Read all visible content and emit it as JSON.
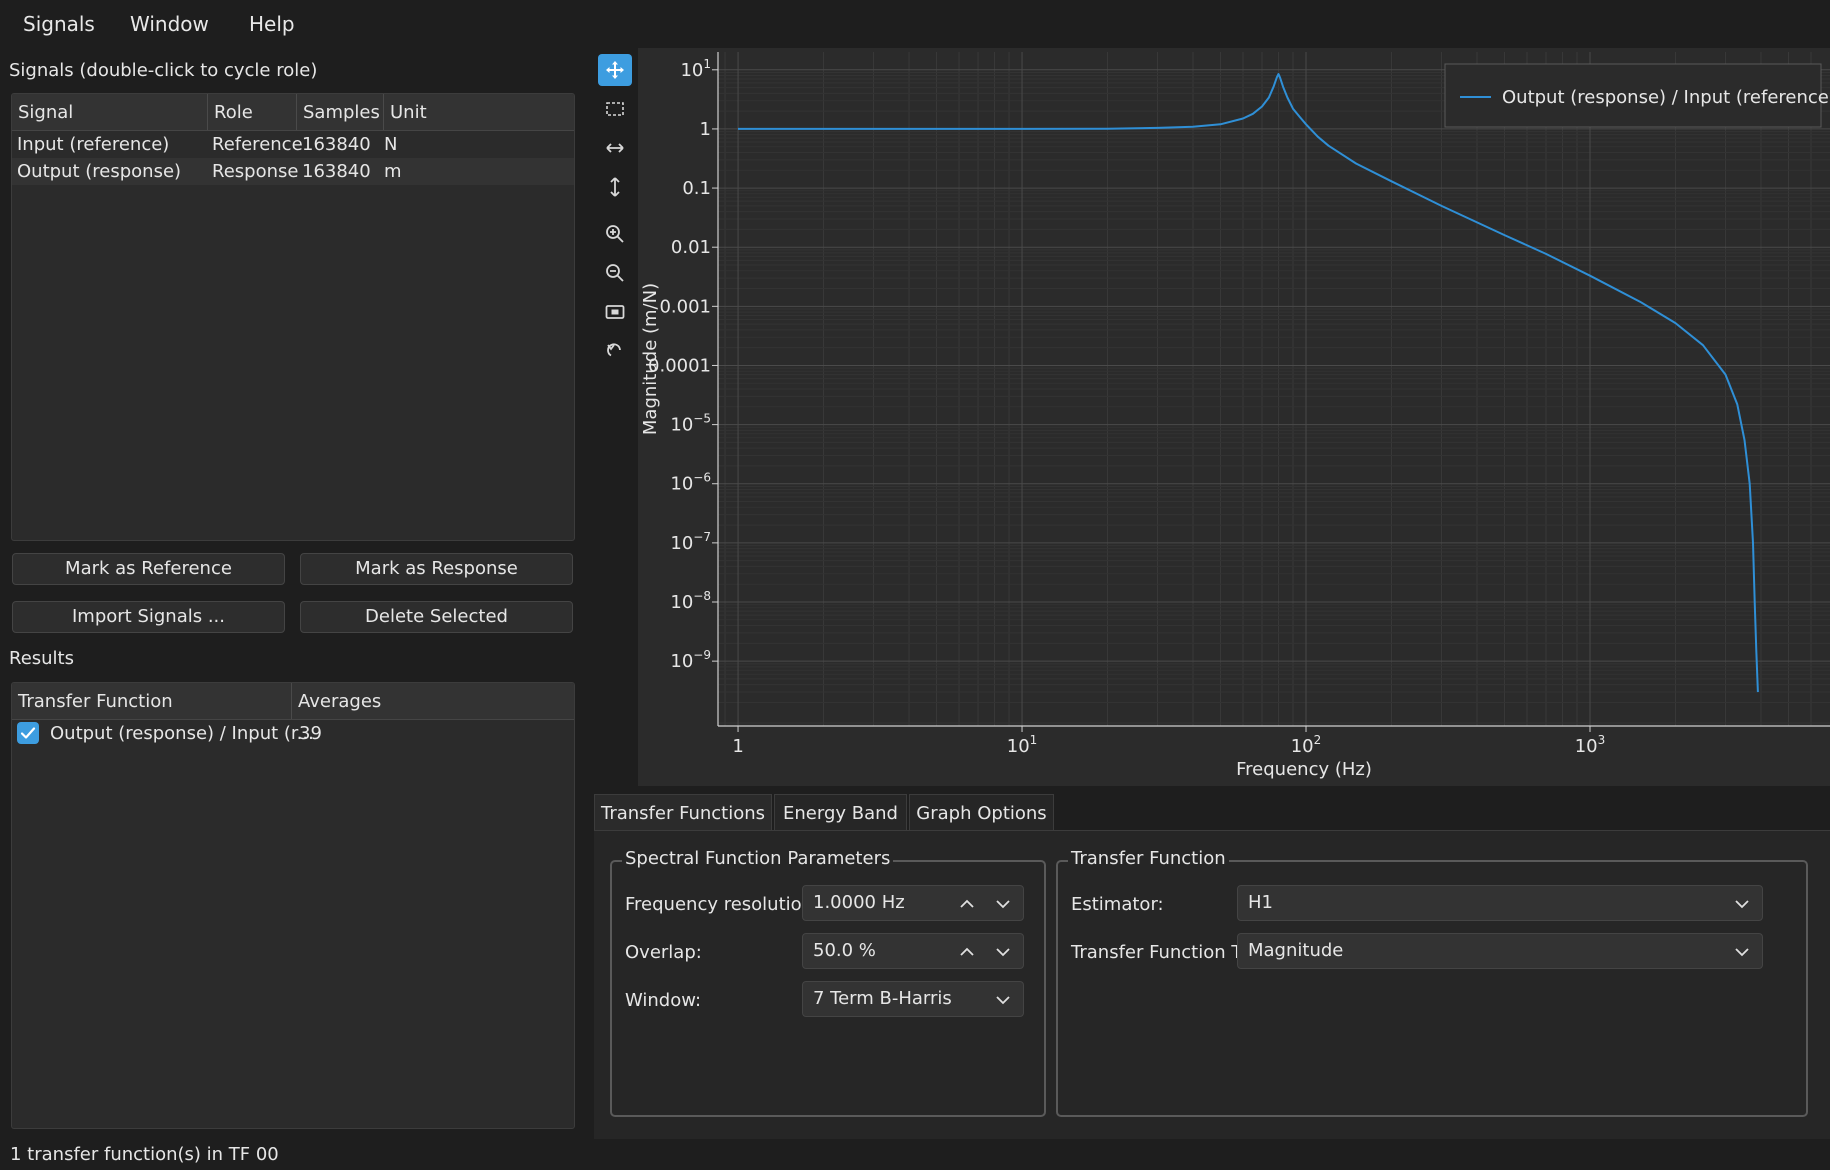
{
  "menu": [
    "Signals",
    "Window",
    "Help"
  ],
  "signals": {
    "title": "Signals (double-click to cycle role)",
    "columns": [
      "Signal",
      "Role",
      "Samples",
      "Unit"
    ],
    "rows": [
      {
        "signal": "Input (reference)",
        "role": "Reference",
        "samples": "163840",
        "unit": "N"
      },
      {
        "signal": "Output (response)",
        "role": "Response",
        "samples": "163840",
        "unit": "m"
      }
    ]
  },
  "buttons": {
    "mark_reference": "Mark as Reference",
    "mark_response": "Mark as Response",
    "import": "Import Signals ...",
    "delete": "Delete Selected"
  },
  "results": {
    "title": "Results",
    "columns": [
      "Transfer Function",
      "Averages"
    ],
    "rows": [
      {
        "name": "Output (response) / Input (r...",
        "averages": "39",
        "checked": true
      }
    ]
  },
  "status": "1 transfer function(s) in TF 00",
  "tools": [
    "pan-icon",
    "box-zoom-icon",
    "zoom-x-icon",
    "zoom-y-icon",
    "zoom-in-icon",
    "zoom-out-icon",
    "fit-view-icon",
    "reset-icon"
  ],
  "tabs": [
    "Transfer Functions",
    "Energy Band",
    "Graph Options"
  ],
  "spectral": {
    "title": "Spectral Function Parameters",
    "freq_label": "Frequency resolution:",
    "freq_value": "1.0000 Hz",
    "overlap_label": "Overlap:",
    "overlap_value": "50.0 %",
    "window_label": "Window:",
    "window_value": "7 Term B-Harris"
  },
  "tf": {
    "title": "Transfer Function",
    "estimator_label": "Estimator:",
    "estimator_value": "H1",
    "type_label": "Transfer Function Type:",
    "type_value": "Magnitude"
  },
  "colors": {
    "accent": "#3d9de0",
    "curve": "#2f8fd6",
    "plot_bg": "#2b2b2b",
    "grid": "#4a4a4a"
  },
  "chart_data": {
    "type": "line",
    "xlabel": "Frequency (Hz)",
    "ylabel": "Magnitude (m/N)",
    "x_scale": "log",
    "y_scale": "log",
    "xlim": [
      0.85,
      7000
    ],
    "ylim": [
      8e-11,
      20
    ],
    "x_ticks": [
      {
        "value": 1,
        "label": "1"
      },
      {
        "value": 10,
        "label": "10",
        "sup": "1"
      },
      {
        "value": 100,
        "label": "10",
        "sup": "2"
      },
      {
        "value": 1000,
        "label": "10",
        "sup": "3"
      }
    ],
    "y_ticks": [
      {
        "value": 10,
        "label": "10",
        "sup": "1"
      },
      {
        "value": 1,
        "label": "1"
      },
      {
        "value": 0.1,
        "label": "0.1"
      },
      {
        "value": 0.01,
        "label": "0.01"
      },
      {
        "value": 0.001,
        "label": "0.001"
      },
      {
        "value": 0.0001,
        "label": "0.0001"
      },
      {
        "value": 1e-05,
        "label": "10",
        "sup": "−5"
      },
      {
        "value": 1e-06,
        "label": "10",
        "sup": "−6"
      },
      {
        "value": 1e-07,
        "label": "10",
        "sup": "−7"
      },
      {
        "value": 1e-08,
        "label": "10",
        "sup": "−8"
      },
      {
        "value": 1e-09,
        "label": "10",
        "sup": "−9"
      }
    ],
    "grid": true,
    "legend": "top-right",
    "series": [
      {
        "name": "Output (response) / Input (reference)",
        "x": [
          1,
          5,
          10,
          20,
          30,
          40,
          50,
          60,
          65,
          70,
          74,
          77,
          79,
          80,
          81,
          83,
          86,
          90,
          95,
          100,
          110,
          120,
          150,
          200,
          300,
          500,
          700,
          1000,
          1500,
          2000,
          2500,
          3000,
          3300,
          3500,
          3650,
          3750,
          3800,
          3850,
          3900
        ],
        "y": [
          1,
          1,
          1,
          1.01,
          1.04,
          1.09,
          1.2,
          1.5,
          1.8,
          2.4,
          3.4,
          5.3,
          7.5,
          8.5,
          7.4,
          5.2,
          3.4,
          2.2,
          1.6,
          1.2,
          0.74,
          0.52,
          0.26,
          0.13,
          0.05,
          0.016,
          0.0077,
          0.0033,
          0.0012,
          0.00052,
          0.00022,
          7e-05,
          2.2e-05,
          5.5e-06,
          1e-06,
          1e-07,
          1e-08,
          1.5e-09,
          3e-10
        ]
      }
    ]
  }
}
